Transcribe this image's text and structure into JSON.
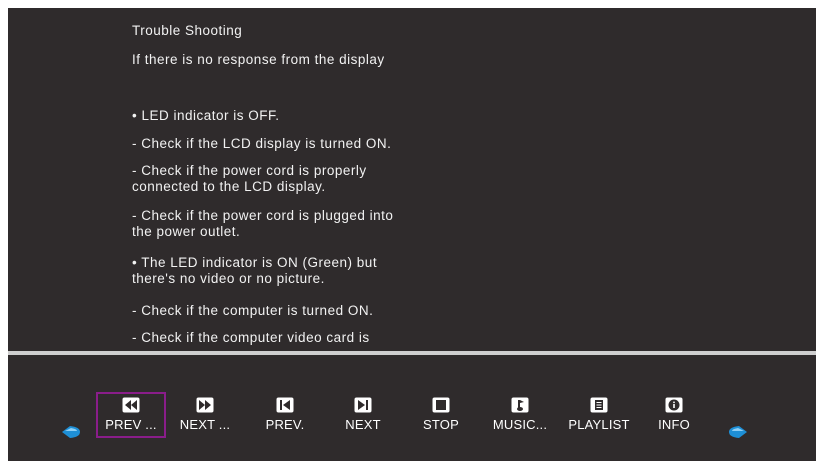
{
  "content": {
    "title": "Trouble Shooting",
    "subtitle": "If there is no response from the display",
    "lines": [
      "• LED indicator is OFF.",
      "- Check if the LCD display is turned ON.",
      "- Check if the power cord is properly\nconnected to the LCD display.",
      "- Check if the power cord is plugged into\nthe power outlet.",
      "• The LED indicator is ON (Green) but\nthere's no video or no picture.",
      "- Check if the computer is turned ON.",
      "- Check if the computer video card is"
    ]
  },
  "controls": {
    "prev_page": {
      "label": "PREV ...",
      "icon": "prev-page-icon"
    },
    "next_page": {
      "label": "NEXT ...",
      "icon": "next-page-icon"
    },
    "prev": {
      "label": "PREV.",
      "icon": "prev-track-icon"
    },
    "next": {
      "label": "NEXT",
      "icon": "next-track-icon"
    },
    "stop": {
      "label": "STOP",
      "icon": "stop-icon"
    },
    "music": {
      "label": "MUSIC...",
      "icon": "music-icon"
    },
    "playlist": {
      "label": "PLAYLIST",
      "icon": "playlist-icon"
    },
    "info": {
      "label": "INFO",
      "icon": "info-icon"
    },
    "selected": "prev_page"
  },
  "colors": {
    "background": "#2f2b2c",
    "divider": "#cfcfcf",
    "selection": "#8a1d8a",
    "arrow": "#1e8fd6"
  }
}
